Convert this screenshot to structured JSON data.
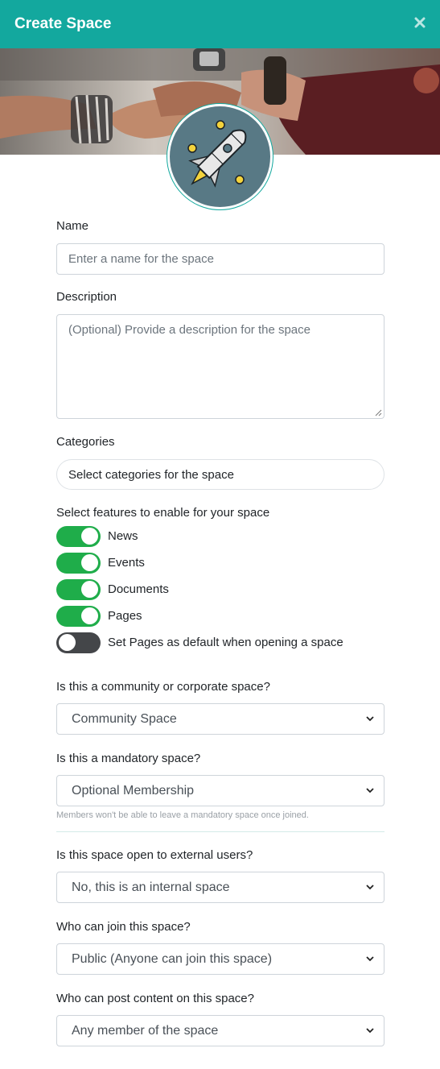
{
  "header": {
    "title": "Create Space",
    "close_icon": "close-icon"
  },
  "colors": {
    "header_bg": "#13a89e",
    "toggle_on": "#1fad4a",
    "toggle_off": "#444649",
    "avatar_bg": "#587985"
  },
  "banner": {
    "image": "hands-stacked-teamwork-photo"
  },
  "avatar": {
    "icon": "rocket-icon"
  },
  "name": {
    "label": "Name",
    "placeholder": "Enter a name for the space"
  },
  "description": {
    "label": "Description",
    "placeholder": "(Optional) Provide a description for the space"
  },
  "categories": {
    "label": "Categories",
    "placeholder": "Select categories for the space"
  },
  "features": {
    "label": "Select features to enable for your space",
    "items": [
      {
        "label": "News",
        "enabled": true
      },
      {
        "label": "Events",
        "enabled": true
      },
      {
        "label": "Documents",
        "enabled": true
      },
      {
        "label": "Pages",
        "enabled": true
      },
      {
        "label": "Set Pages as default when opening a space",
        "enabled": false
      }
    ]
  },
  "space_type": {
    "label": "Is this a community or corporate space?",
    "value": "Community Space"
  },
  "mandatory": {
    "label": "Is this a mandatory space?",
    "value": "Optional Membership",
    "help": "Members won't be able to leave a mandatory space once joined."
  },
  "external": {
    "label": "Is this space open to external users?",
    "value": "No, this is an internal space"
  },
  "join": {
    "label": "Who can join this space?",
    "value": "Public (Anyone can join this space)"
  },
  "post": {
    "label": "Who can post content on this space?",
    "value": "Any member of the space"
  }
}
